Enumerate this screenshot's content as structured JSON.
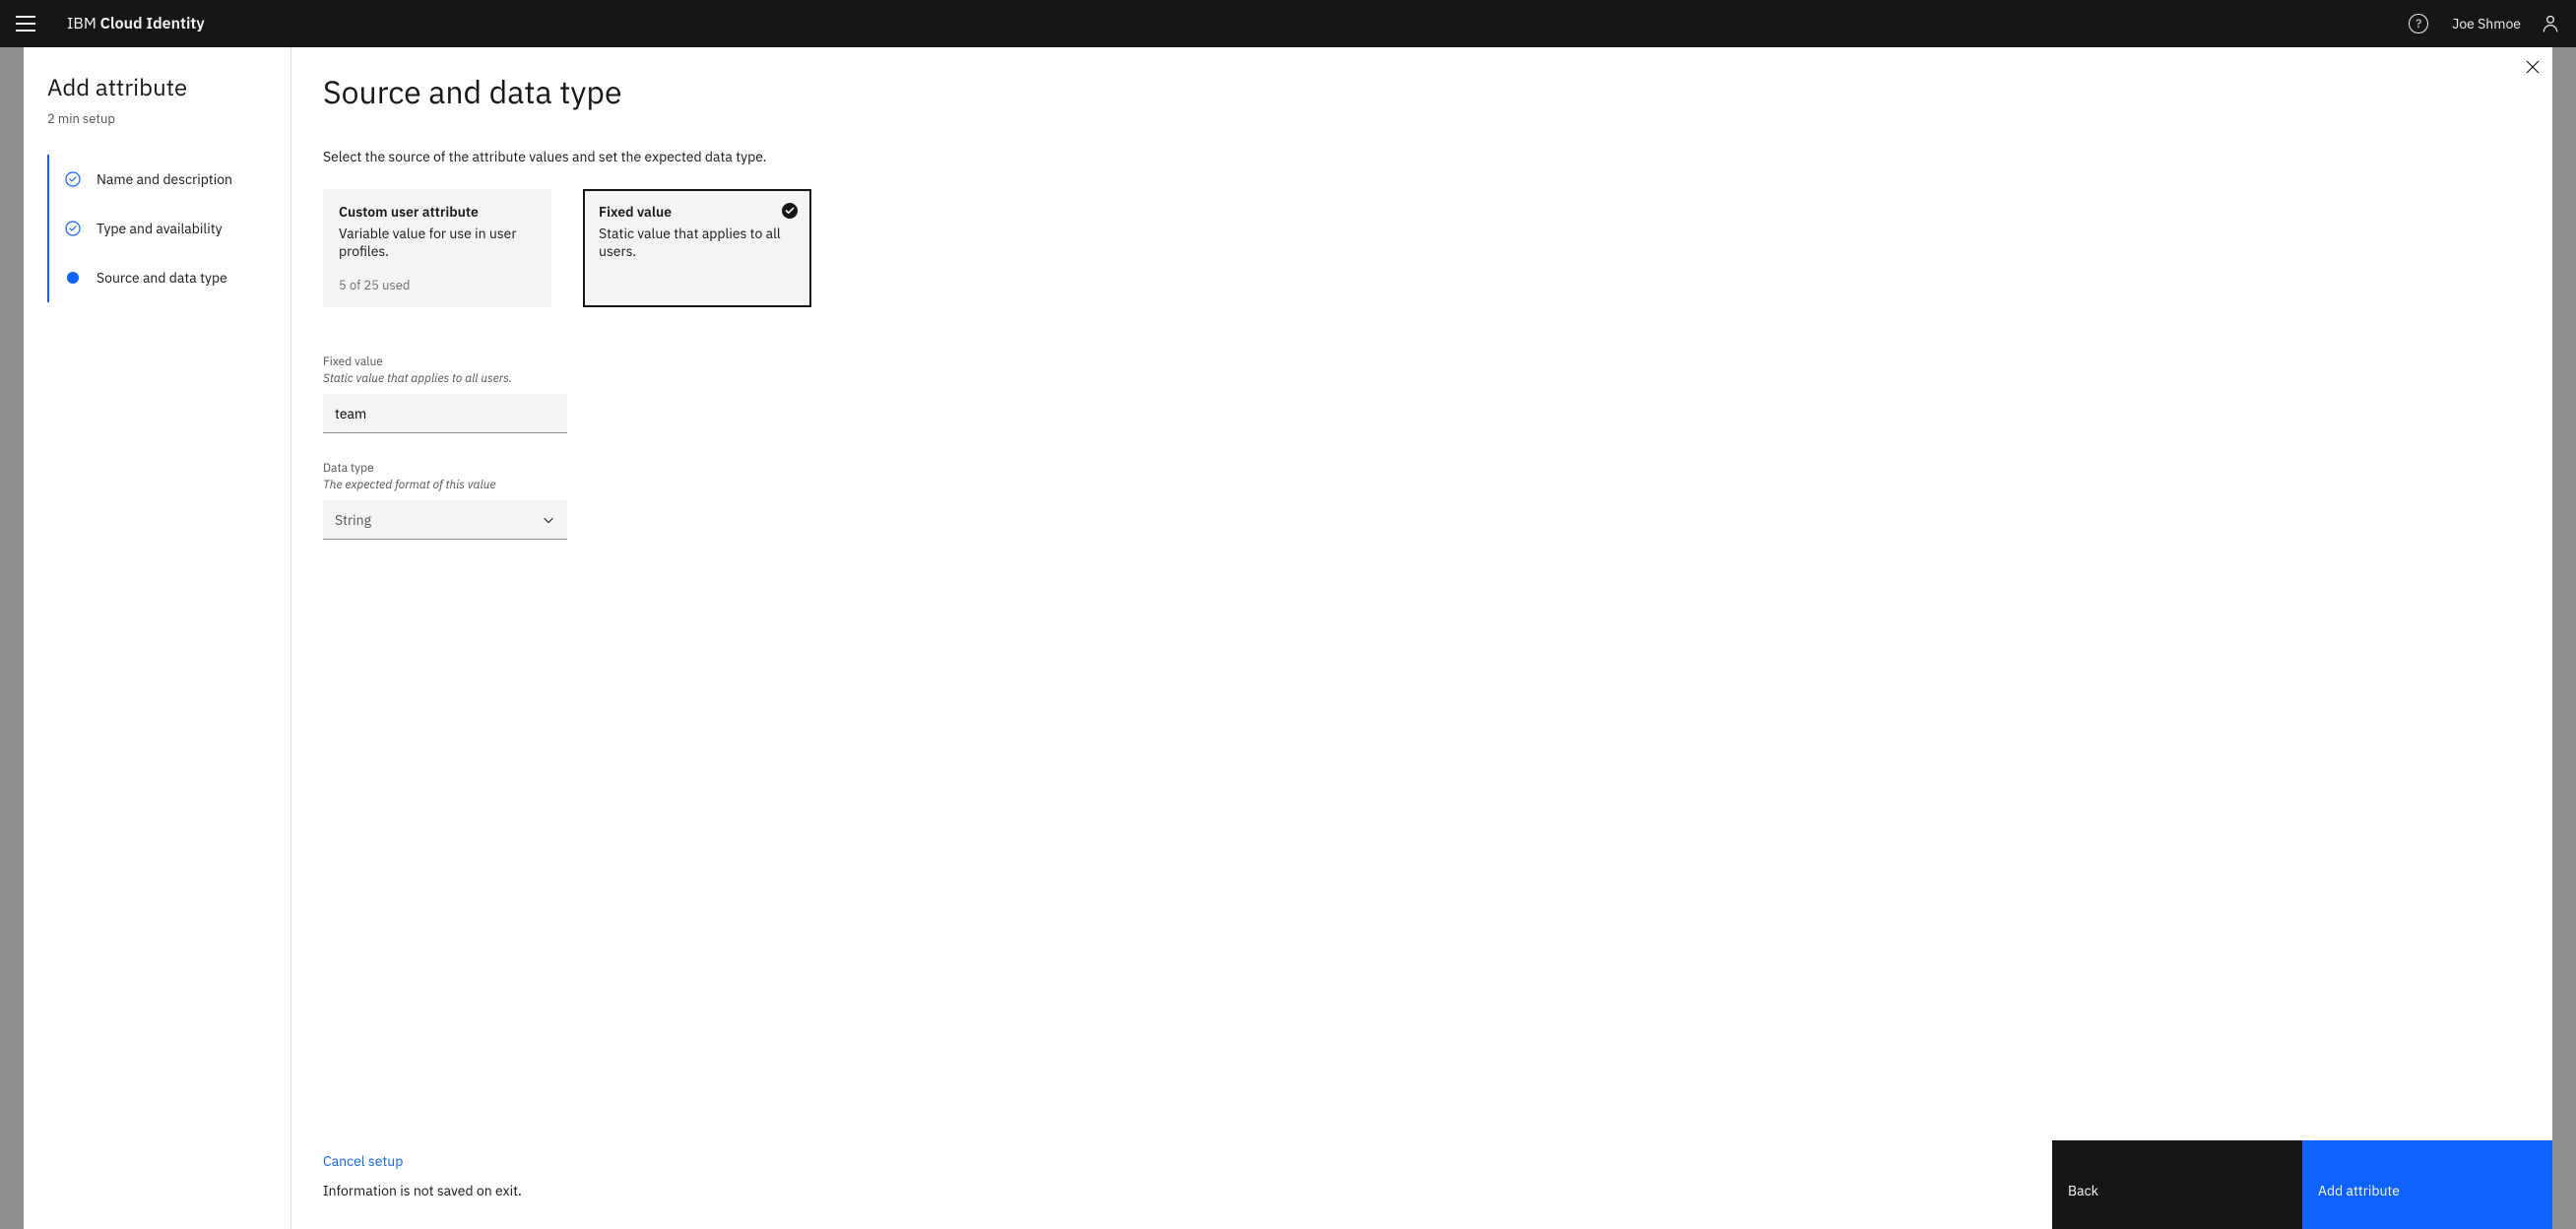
{
  "header": {
    "brand_light": "IBM",
    "brand_bold": "Cloud Identity",
    "username": "Joe Shmoe"
  },
  "sidebar": {
    "title": "Add attribute",
    "subtitle": "2 min setup",
    "steps": [
      {
        "label": "Name and description",
        "state": "complete"
      },
      {
        "label": "Type and availability",
        "state": "complete"
      },
      {
        "label": "Source and data type",
        "state": "current"
      }
    ]
  },
  "main": {
    "title": "Source and data type",
    "description": "Select the source of the attribute values and set the expected data type.",
    "tiles": [
      {
        "title": "Custom user attribute",
        "desc": "Variable value for use in user profiles.",
        "footer": "5 of 25 used",
        "selected": false
      },
      {
        "title": "Fixed value",
        "desc": "Static value that applies to all users.",
        "footer": "",
        "selected": true
      }
    ],
    "fixed_value": {
      "label": "Fixed value",
      "helper": "Static value that applies to all users.",
      "value": "team"
    },
    "data_type": {
      "label": "Data type",
      "helper": "The expected format of this value",
      "selected": "String"
    }
  },
  "footer": {
    "cancel": "Cancel setup",
    "not_saved": "Information is not saved on exit.",
    "back": "Back",
    "primary": "Add attribute"
  }
}
